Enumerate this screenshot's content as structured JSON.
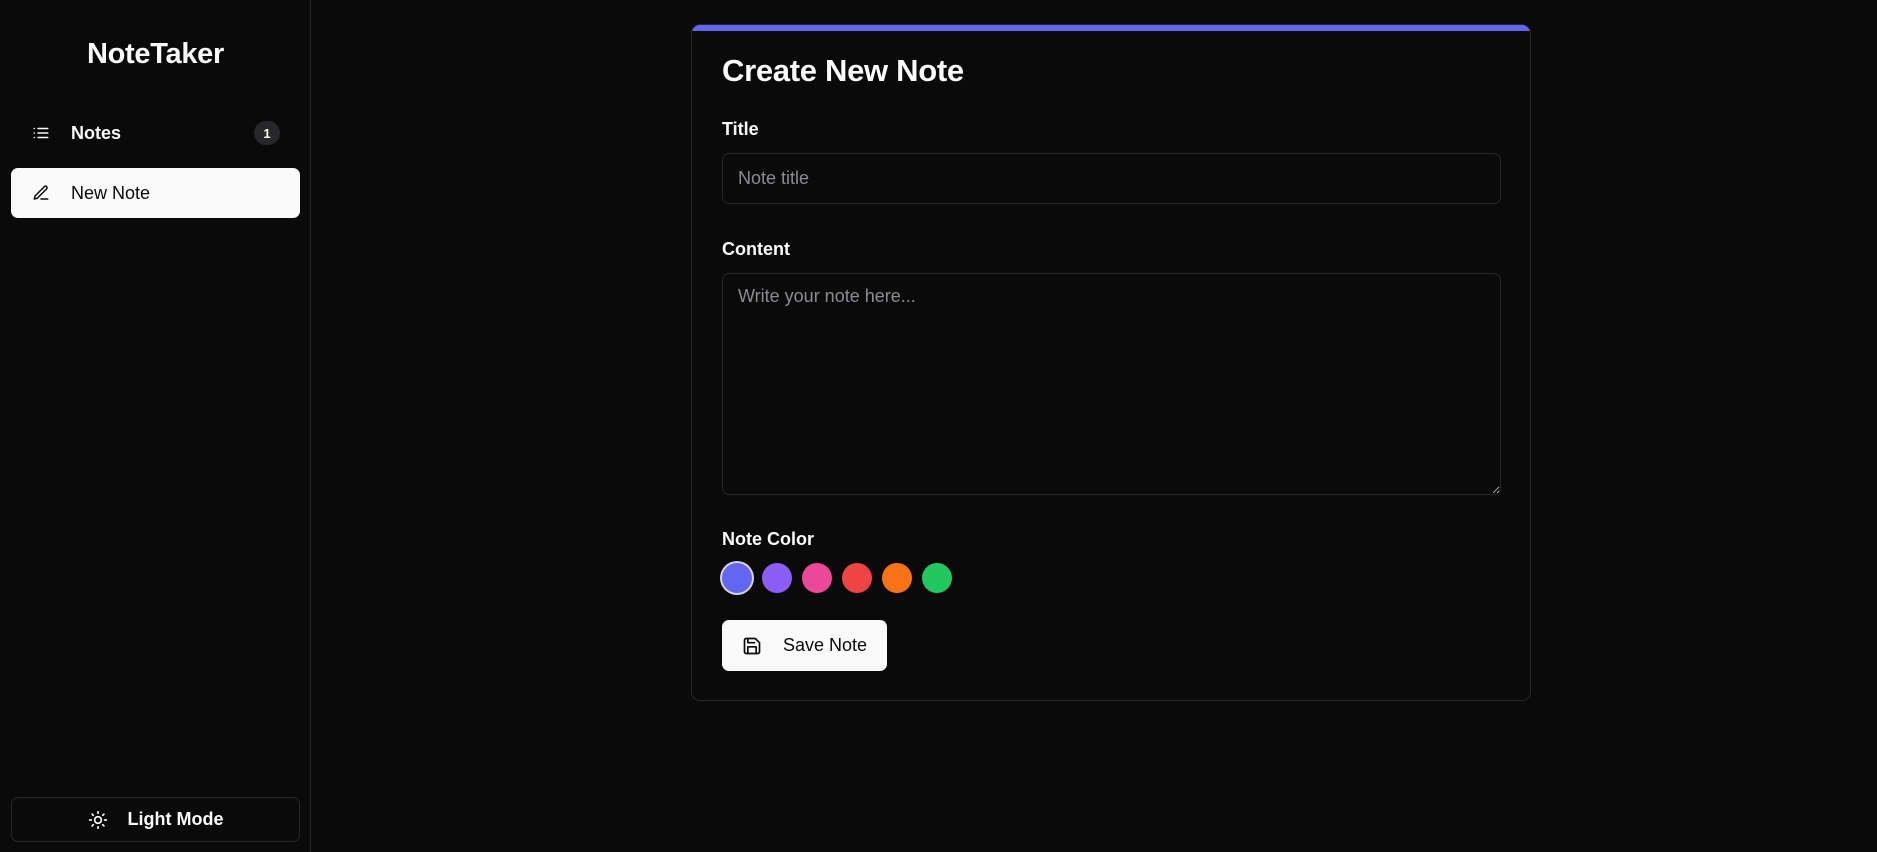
{
  "app": {
    "title": "NoteTaker"
  },
  "sidebar": {
    "items": [
      {
        "label": "Notes",
        "icon": "list-icon",
        "count": "1"
      },
      {
        "label": "New Note",
        "icon": "pencil-icon"
      }
    ],
    "theme_toggle": {
      "label": "Light Mode",
      "icon": "sun-icon"
    }
  },
  "form": {
    "heading": "Create New Note",
    "accent_color": "#6366f1",
    "title_field": {
      "label": "Title",
      "value": "",
      "placeholder": "Note title"
    },
    "content_field": {
      "label": "Content",
      "value": "",
      "placeholder": "Write your note here..."
    },
    "color_label": "Note Color",
    "colors": [
      "#6366f1",
      "#8b5cf6",
      "#ec4899",
      "#ef4444",
      "#f97316",
      "#22c55e"
    ],
    "selected_color": "#6366f1",
    "save_label": "Save Note",
    "save_icon": "save-icon"
  }
}
